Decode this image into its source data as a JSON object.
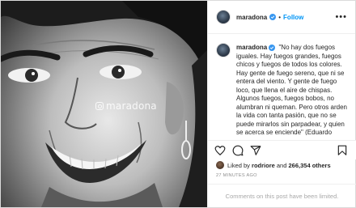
{
  "photo": {
    "watermark": "maradona",
    "description_icon": "instagram-icon"
  },
  "header": {
    "username": "maradona",
    "separator": "•",
    "follow_label": "Follow",
    "more_label": "•••"
  },
  "caption": {
    "username": "maradona",
    "text": "\"No hay dos fuegos iguales. Hay fuegos grandes, fuegos chicos y fuegos de todos los colores. Hay gente de fuego sereno, que ni se entera del viento. Y gente de fuego loco, que llena el aire de chispas. Algunos fuegos, fuegos bobos, no alumbran ni queman. Pero otros arden la vida con tanta pasión, que no se puede mirarlos sin parpadear, y quien se acerca se enciende\" (Eduardo Galeano)"
  },
  "actions": {
    "icons": [
      "heart-icon",
      "comment-icon",
      "share-icon",
      "bookmark-icon"
    ]
  },
  "likes": {
    "prefix": "Liked by ",
    "user": "rodriore",
    "middle": " and ",
    "count": "266,354 others"
  },
  "timestamp": "27 MINUTES AGO",
  "comments_notice": "Comments on this post have been limited.",
  "colors": {
    "accent": "#0095f6",
    "verified": "#3897f0",
    "muted": "#8e8e8e",
    "border": "#dbdbdb"
  }
}
